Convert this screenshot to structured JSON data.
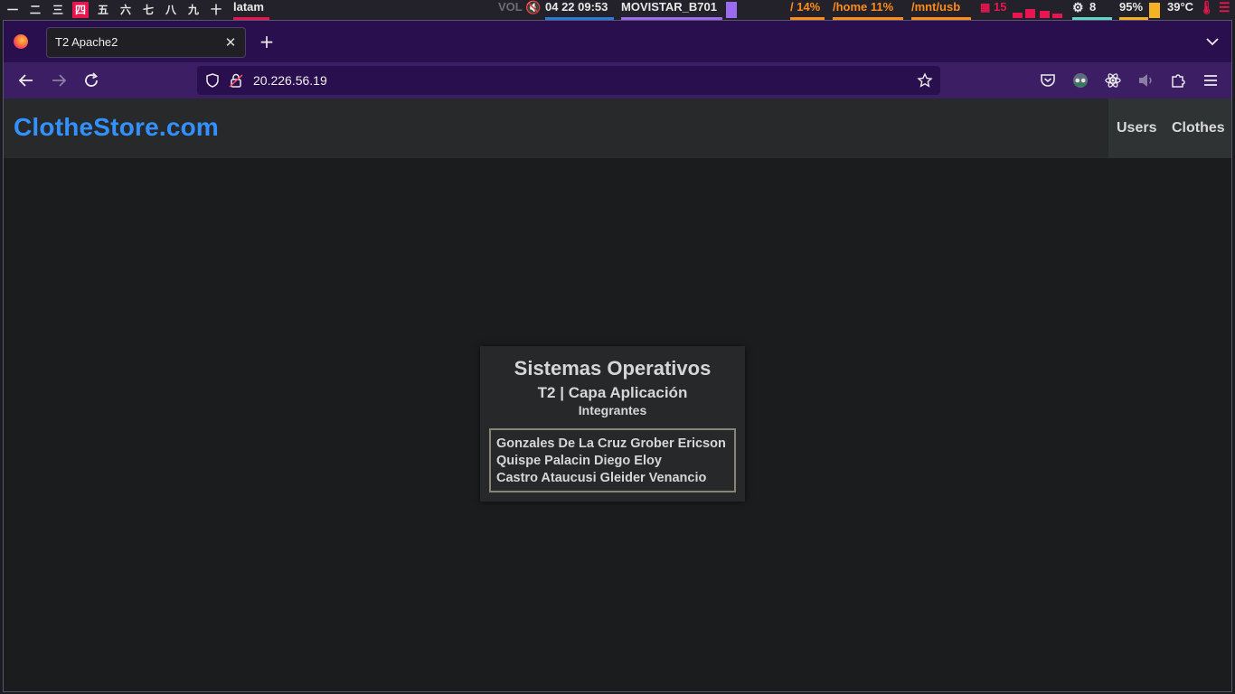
{
  "statusbar": {
    "workspaces": [
      "一",
      "二",
      "三",
      "四",
      "五",
      "六",
      "七",
      "八",
      "九",
      "十"
    ],
    "active_workspace": "四",
    "layout": "latam",
    "volume": "VOL",
    "datetime": "04 22 09:53",
    "wifi": "MOVISTAR_B701",
    "disk_root": "/ 14%",
    "disk_home": "/home 11%",
    "disk_usb": "/mnt/usb",
    "cpu_temp_label": "15",
    "cpu_count": "8",
    "battery": "95%",
    "temperature": "39°C",
    "colors": {
      "accent": "#e7164f",
      "orange": "#ff8c1a",
      "teal": "#60d6c8",
      "yellow": "#f5b324"
    }
  },
  "browser": {
    "tab_title": "T2 Apache2",
    "url": "20.226.56.19",
    "colors": {
      "tabbar": "#2a0f4e",
      "navbar": "#3b1e64"
    }
  },
  "site": {
    "brand": "ClotheStore.com",
    "nav": [
      "Users",
      "Clothes"
    ],
    "card": {
      "title": "Sistemas Operativos",
      "subtitle": "T2 | Capa Aplicación",
      "section": "Integrantes",
      "members": [
        "Gonzales De La Cruz Grober Ericson",
        "Quispe Palacin Diego Eloy",
        "Castro Ataucusi Gleider Venancio"
      ]
    },
    "colors": {
      "brand": "#3391ff",
      "background": "#1b1c1e",
      "header": "#27292b"
    }
  }
}
